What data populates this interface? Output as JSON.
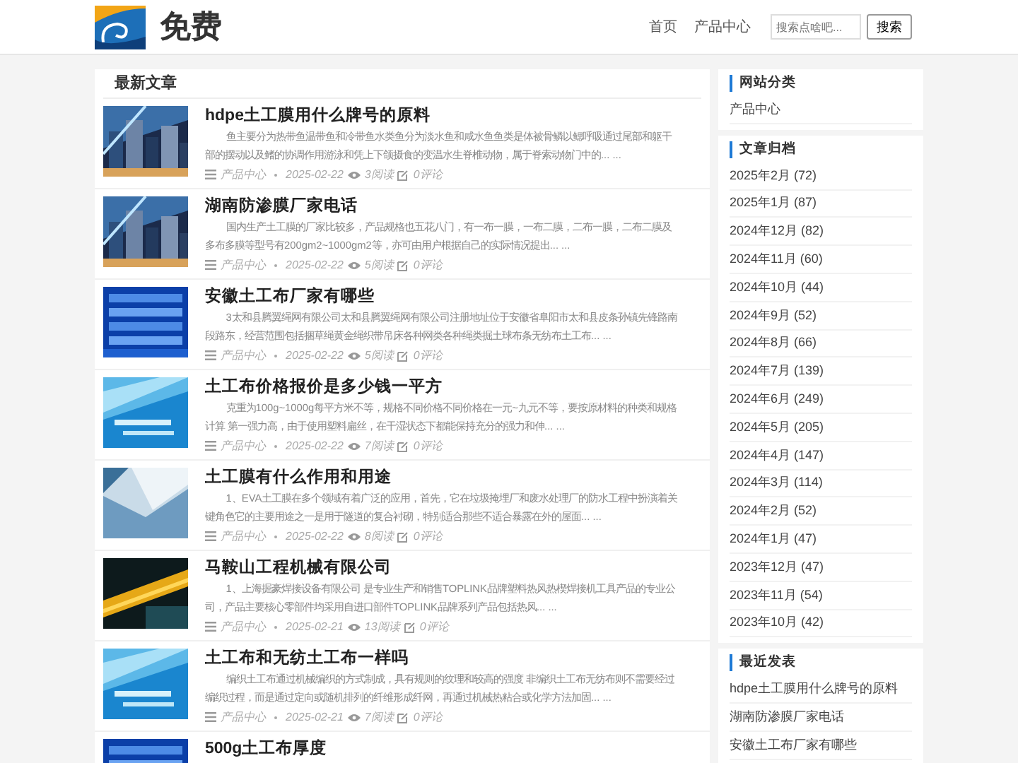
{
  "header": {
    "logo_text": "免费",
    "nav": [
      {
        "label": "首页"
      },
      {
        "label": "产品中心"
      }
    ],
    "search": {
      "placeholder": "搜索点啥吧...",
      "button": "搜索"
    }
  },
  "main": {
    "title": "最新文章",
    "articles": [
      {
        "title": "hdpe土工膜用什么牌号的原料",
        "excerpt": "鱼主要分为热带鱼温带鱼和冷带鱼水类鱼分为淡水鱼和咸水鱼鱼类是体被骨鳞以鳃呼吸通过尾部和躯干部的摆动以及鳍的协调作用游泳和凭上下颌摄食的变温水生脊椎动物，属于脊索动物门中的... ...",
        "category": "产品中心",
        "date": "2025-02-22",
        "views": "3阅读",
        "comments": "0评论"
      },
      {
        "title": "湖南防渗膜厂家电话",
        "excerpt": "国内生产土工膜的厂家比较多，产品规格也五花八门，有一布一膜，一布二膜，二布一膜，二布二膜及多布多膜等型号有200gm2~1000gm2等，亦可由用户根据自己的实际情况提出... ...",
        "category": "产品中心",
        "date": "2025-02-22",
        "views": "5阅读",
        "comments": "0评论"
      },
      {
        "title": "安徽土工布厂家有哪些",
        "excerpt": "3太和县腾翼绳网有限公司太和县腾翼绳网有限公司注册地址位于安徽省阜阳市太和县皮条孙镇先锋路南段路东，经营范围包括捆草绳黄金绳织带吊床各种网类各种绳类掘土球布条无纺布土工布... ...",
        "category": "产品中心",
        "date": "2025-02-22",
        "views": "5阅读",
        "comments": "0评论"
      },
      {
        "title": "土工布价格报价是多少钱一平方",
        "excerpt": "克重为100g~1000g每平方米不等，规格不同价格不同价格在一元~九元不等，要按原材料的种类和规格计算 第一强力高，由于使用塑料扁丝，在干湿状态下都能保持充分的强力和伸... ...",
        "category": "产品中心",
        "date": "2025-02-22",
        "views": "7阅读",
        "comments": "0评论"
      },
      {
        "title": "土工膜有什么作用和用途",
        "excerpt": "1、EVA土工膜在多个领域有着广泛的应用，首先，它在垃圾掩埋厂和废水处理厂的防水工程中扮演着关键角色它的主要用途之一是用于隧道的复合衬砌，特别适合那些不适合暴露在外的屋面... ...",
        "category": "产品中心",
        "date": "2025-02-22",
        "views": "8阅读",
        "comments": "0评论"
      },
      {
        "title": "马鞍山工程机械有限公司",
        "excerpt": "1、上海掘豪焊接设备有限公司 是专业生产和销售TOPLINK品牌塑料热风热楔焊接机工具产品的专业公司，产品主要核心零部件均采用自进口部件TOPLINK品牌系列产品包括热风... ...",
        "category": "产品中心",
        "date": "2025-02-21",
        "views": "13阅读",
        "comments": "0评论"
      },
      {
        "title": "土工布和无纺土工布一样吗",
        "excerpt": "编织土工布通过机械编织的方式制成，具有规则的纹理和较高的强度 非编织土工布无纺布则不需要经过编织过程，而是通过定向或随机排列的纤维形成纤网，再通过机械热粘合或化学方法加固... ...",
        "category": "产品中心",
        "date": "2025-02-21",
        "views": "7阅读",
        "comments": "0评论"
      },
      {
        "title": "500g土工布厚度"
      }
    ]
  },
  "sidebar": [
    {
      "title": "网站分类",
      "items": [
        "产品中心"
      ]
    },
    {
      "title": "文章归档",
      "items": [
        "2025年2月 (72)",
        "2025年1月 (87)",
        "2024年12月 (82)",
        "2024年11月 (60)",
        "2024年10月 (44)",
        "2024年9月 (52)",
        "2024年8月 (66)",
        "2024年7月 (139)",
        "2024年6月 (249)",
        "2024年5月 (205)",
        "2024年4月 (147)",
        "2024年3月 (114)",
        "2024年2月 (52)",
        "2024年1月 (47)",
        "2023年12月 (47)",
        "2023年11月 (54)",
        "2023年10月 (42)"
      ]
    },
    {
      "title": "最近发表",
      "items": [
        "hdpe土工膜用什么牌号的原料",
        "湖南防渗膜厂家电话",
        "安徽土工布厂家有哪些"
      ]
    }
  ]
}
